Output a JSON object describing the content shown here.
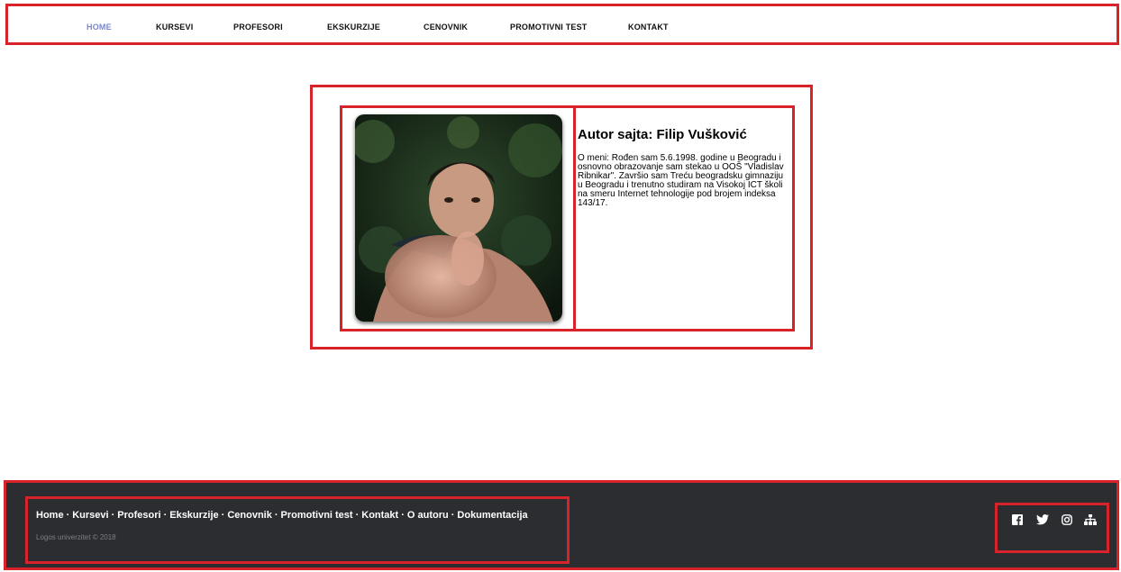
{
  "nav": {
    "items": [
      {
        "label": "HOME",
        "active": true
      },
      {
        "label": "KURSEVI"
      },
      {
        "label": "PROFESORI"
      },
      {
        "label": "EKSKURZIJE"
      },
      {
        "label": "CENOVNIK"
      },
      {
        "label": "PROMOTIVNI TEST"
      },
      {
        "label": "KONTAKT"
      }
    ]
  },
  "author": {
    "title": "Autor sajta: Filip Vušković",
    "bio": "O meni: Rođen sam 5.6.1998. godine u Beogradu i osnovno obrazovanje sam stekao u OOŠ \"Vladislav Ribnikar\". Završio sam Treću beogradsku gimnaziju u Beogradu i trenutno studiram na Visokoj ICT školi na smeru Internet tehnologije pod brojem indeksa 143/17."
  },
  "footer": {
    "links": [
      "Home",
      "Kursevi",
      "Profesori",
      "Ekskurzije",
      "Cenovnik",
      "Promotivni test",
      "Kontakt",
      "O autoru",
      "Dokumentacija"
    ],
    "separator": "·",
    "copyright": "Logos univerzitet © 2018",
    "social_icons": [
      "facebook-icon",
      "twitter-icon",
      "instagram-icon",
      "sitemap-icon"
    ]
  },
  "colors": {
    "outline": "#d8232a",
    "nav_active": "#7b86c9",
    "footer_bg": "#2b2d30"
  }
}
